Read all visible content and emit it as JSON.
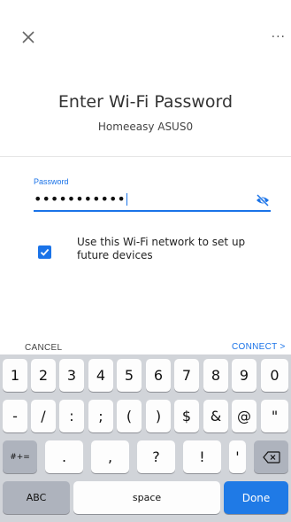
{
  "header": {
    "close_icon": "close-icon",
    "more_text": "...",
    "title": "Enter Wi-Fi Password",
    "network_name": "Homeeasy ASUS0"
  },
  "password": {
    "label": "Password",
    "value": "•••••••••••",
    "visibility_icon": "eye-off-icon"
  },
  "remember": {
    "checked": true,
    "text": "Use this Wi-Fi network to set up future devices"
  },
  "actions": {
    "cancel": "CANCEL",
    "connect": "CONNECT >"
  },
  "keyboard": {
    "row1": [
      "1",
      "2",
      "3",
      "4",
      "5",
      "6",
      "7",
      "8",
      "9",
      "0"
    ],
    "row2": [
      "-",
      "/",
      ":",
      ";",
      "(",
      ")",
      "$",
      "&",
      "@",
      "\""
    ],
    "row3": [
      ".",
      ",",
      "?",
      "!",
      "'"
    ],
    "symbols_key": "#+=",
    "backspace_icon": "backspace-icon",
    "abc_key": "ABC",
    "space_key": "space",
    "done_key": "Done"
  },
  "colors": {
    "accent": "#1a73e8",
    "done_key": "#1f7ae6",
    "keyboard_bg": "#d1d4d9"
  }
}
